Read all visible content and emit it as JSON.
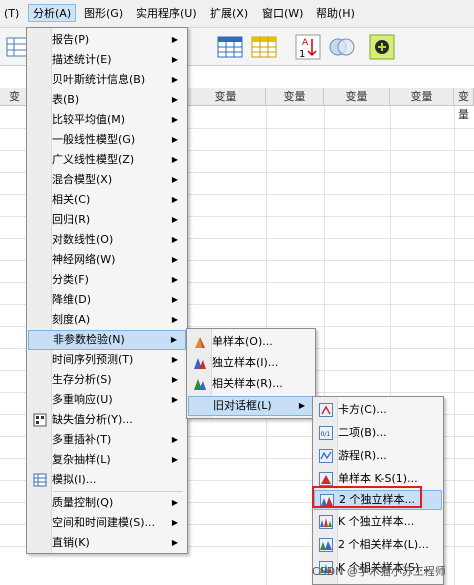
{
  "menubar": {
    "items": [
      {
        "label": "(T)"
      },
      {
        "label": "分析(A)"
      },
      {
        "label": "图形(G)"
      },
      {
        "label": "实用程序(U)"
      },
      {
        "label": "扩展(X)"
      },
      {
        "label": "窗口(W)"
      },
      {
        "label": "帮助(H)"
      }
    ]
  },
  "sheet": {
    "headers": [
      "变",
      "变量",
      "变量",
      "变量",
      "变量",
      "变量"
    ]
  },
  "analyze_menu": {
    "items": [
      {
        "label": "报告(P)"
      },
      {
        "label": "描述统计(E)"
      },
      {
        "label": "贝叶斯统计信息(B)"
      },
      {
        "label": "表(B)"
      },
      {
        "label": "比较平均值(M)"
      },
      {
        "label": "一般线性模型(G)"
      },
      {
        "label": "广义线性模型(Z)"
      },
      {
        "label": "混合模型(X)"
      },
      {
        "label": "相关(C)"
      },
      {
        "label": "回归(R)"
      },
      {
        "label": "对数线性(O)"
      },
      {
        "label": "神经网络(W)"
      },
      {
        "label": "分类(F)"
      },
      {
        "label": "降维(D)"
      },
      {
        "label": "刻度(A)"
      },
      {
        "label": "非参数检验(N)"
      },
      {
        "label": "时间序列预测(T)"
      },
      {
        "label": "生存分析(S)"
      },
      {
        "label": "多重响应(U)"
      },
      {
        "label": "缺失值分析(Y)..."
      },
      {
        "label": "多重插补(T)"
      },
      {
        "label": "复杂抽样(L)"
      },
      {
        "label": "模拟(I)..."
      },
      {
        "label": "质量控制(Q)"
      },
      {
        "label": "空间和时间建模(S)..."
      },
      {
        "label": "直销(K)"
      }
    ]
  },
  "nonparam_menu": {
    "items": [
      {
        "label": "单样本(O)..."
      },
      {
        "label": "独立样本(I)..."
      },
      {
        "label": "相关样本(R)..."
      },
      {
        "label": "旧对话框(L)"
      }
    ]
  },
  "legacy_menu": {
    "items": [
      {
        "label": "卡方(C)..."
      },
      {
        "label": "二项(B)..."
      },
      {
        "label": "游程(R)..."
      },
      {
        "label": "单样本 K-S(1)..."
      },
      {
        "label": "2 个独立样本..."
      },
      {
        "label": "K 个独立样本..."
      },
      {
        "label": "2 个相关样本(L)..."
      },
      {
        "label": "K 个相关样本(S)..."
      }
    ]
  },
  "watermark": {
    "text": "CSDN @学术猫小苏工程师"
  },
  "colors": {
    "highlight": "#c6dff7",
    "highlight_border": "#84b0e0",
    "annotation": "#e0201a"
  }
}
